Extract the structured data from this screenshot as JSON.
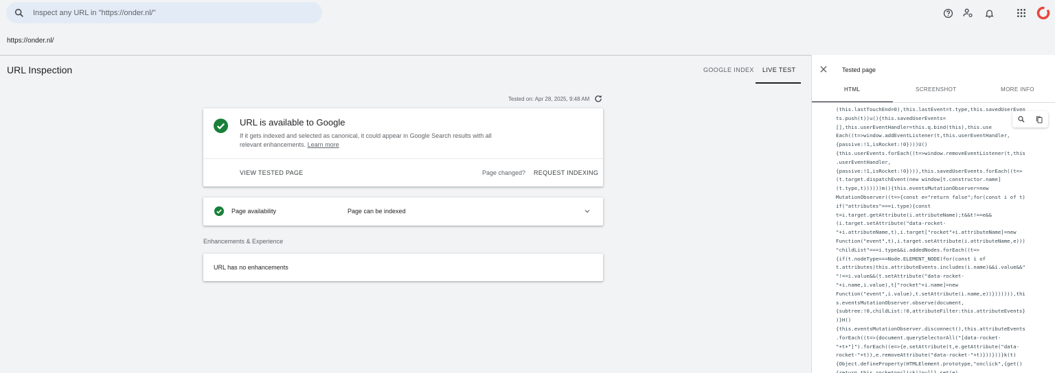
{
  "search": {
    "placeholder": "Inspect any URL in \"https://onder.nl/\""
  },
  "property_url": "https://onder.nl/",
  "header": {
    "title": "URL Inspection",
    "tabs": [
      {
        "label": "GOOGLE INDEX"
      },
      {
        "label": "LIVE TEST"
      }
    ],
    "active_tab": "LIVE TEST"
  },
  "tested_on": "Tested on: Apr 28, 2025, 9:48 AM",
  "status_card": {
    "title": "URL is available to Google",
    "desc": "If it gets indexed and selected as canonical, it could appear in Google Search results with all relevant enhancements.",
    "learn_more": "Learn more",
    "view_tested": "VIEW TESTED PAGE",
    "page_changed": "Page changed?",
    "request_indexing": "REQUEST INDEXING"
  },
  "availability": {
    "label": "Page availability",
    "value": "Page can be indexed"
  },
  "enhancements": {
    "section": "Enhancements & Experience",
    "text": "URL has no enhancements"
  },
  "panel": {
    "title": "Tested page",
    "tabs": [
      {
        "label": "HTML"
      },
      {
        "label": "SCREENSHOT"
      },
      {
        "label": "MORE INFO"
      }
    ],
    "code_lines": [
      "(this.lastTouchEnd=0),this.lastEvent=t.type,this.savedUserEven",
      "ts.push(t))u(){this.savedUserEvents=",
      "[],this.userEventHandler=this.q.bind(this),this.use",
      "Each((t=>window.addEventListener(t,this.userEventHandler,",
      "{passive:!1,isRocket:!0})))U()",
      "{this.userEvents.forEach((t=>window.removeEventListener(t,this",
      ".userEventHandler,",
      "{passive:!1,isRocket:!0}))),this.savedUserEvents.forEach((t=>",
      "(t.target.dispatchEvent(new window[t.constructor.name]",
      "(t.type,t))))))m(){this.eventsMutationObserver=new",
      "MutationObserver((t=>{const e=\"return false\";for(const i of t)",
      "if(\"attributes\"===i.type){const",
      "t=i.target.getAttribute(i.attributeName);t&&t!==e&&",
      "(i.target.setAttribute(\"data-rocket-",
      "\"+i.attributeName,t),i.target[\"rocket\"+i.attributeName]=new",
      "Function(\"event\",t),i.target.setAttribute(i.attributeName,e)))",
      "\"childList\"===i.type&&i.addedNodes.forEach((t=>",
      "{if(t.nodeType===Node.ELEMENT_NODE)for(const i of",
      "t.attributes)this.attributeEvents.includes(i.name)&&i.value&&\"",
      "\"!==i.value&&(t.setAttribute(\"data-rocket-",
      "\"+i.name,i.value),t[\"rocket\"+i.name]=new",
      "Function(\"event\",i.value),t.setAttribute(i.name,e))})))))),thi",
      "s.eventsMutationObserver.observe(document,",
      "{subtree:!0,childList:!0,attributeFilter:this.attributeEvents}",
      ")}H()",
      "{this.eventsMutationObserver.disconnect(),this.attributeEvents",
      ".forEach((t=>{document.querySelectorAll(\"[data-rocket-",
      "\"+t+\"]\").forEach((e=>{e.setAttribute(t,e.getAttribute(\"data-",
      "rocket-\"+t)),e.removeAttribute(\"data-rocket-\"+t)}))}))}k(t)",
      "{Object.defineProperty(HTMLElement.prototype,\"onclick\",{get()",
      "{return this.rocketonclick||null},set(e)"
    ]
  },
  "colors": {
    "success": "#188038",
    "brand_ring": "#e8453c",
    "accent_text": "#202124"
  }
}
